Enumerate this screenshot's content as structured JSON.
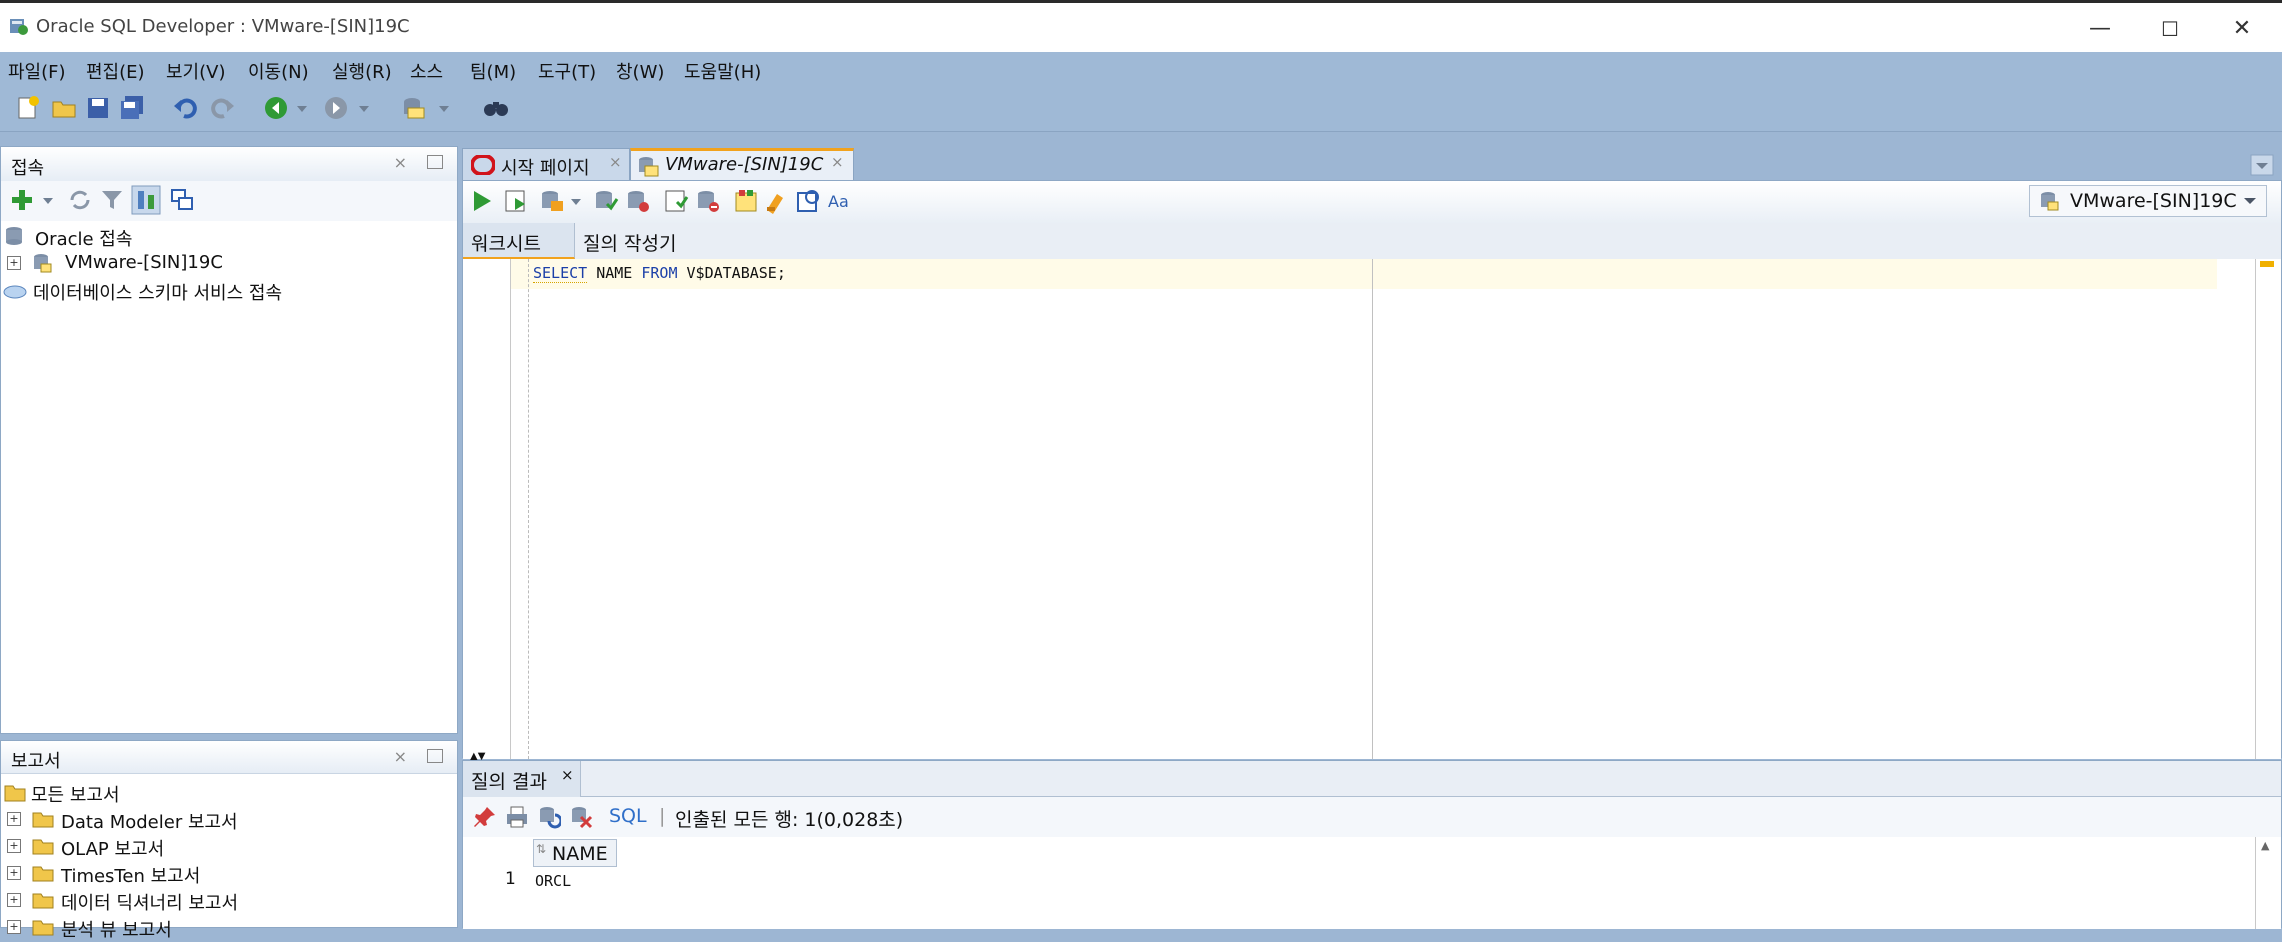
{
  "window": {
    "title": "Oracle SQL Developer : VMware-[SIN]19C",
    "minimize": "—",
    "maximize": "☐",
    "close": "✕"
  },
  "menu": [
    "파일(F)",
    "편집(E)",
    "보기(V)",
    "이동(N)",
    "실행(R)",
    "소스",
    "팀(M)",
    "도구(T)",
    "창(W)",
    "도움말(H)"
  ],
  "connections_panel": {
    "title": "접속",
    "close": "×",
    "tree": {
      "root": "Oracle 접속",
      "child": "VMware-[SIN]19C",
      "cloud": "데이터베이스 스키마 서비스 접속"
    }
  },
  "reports_panel": {
    "title": "보고서",
    "close": "×",
    "items": [
      "모든 보고서",
      "Data Modeler 보고서",
      "OLAP 보고서",
      "TimesTen 보고서",
      "데이터 딕셔너리 보고서",
      "분석 뷰 보고서"
    ]
  },
  "editor_tabs": {
    "start": "시작 페이지",
    "worksheet": "VMware-[SIN]19C",
    "close": "×"
  },
  "connection_selector": "VMware-[SIN]19C",
  "subtabs": {
    "worksheet": "워크시트",
    "query_builder": "질의 작성기"
  },
  "code": {
    "keyword_select": "SELECT",
    "column": "NAME",
    "keyword_from": "FROM",
    "table": "V$DATABASE;"
  },
  "results": {
    "tab": "질의 결과",
    "close": "×",
    "sql_link": "SQL",
    "status": "인출된 모든 행: 1(0,028초)",
    "columns": [
      "NAME"
    ],
    "rows": [
      {
        "num": "1",
        "name": "ORCL"
      }
    ]
  },
  "colors": {
    "chrome": "#9fb9d6",
    "keyword": "#1b3fa8",
    "current_line": "#fffbe8"
  }
}
